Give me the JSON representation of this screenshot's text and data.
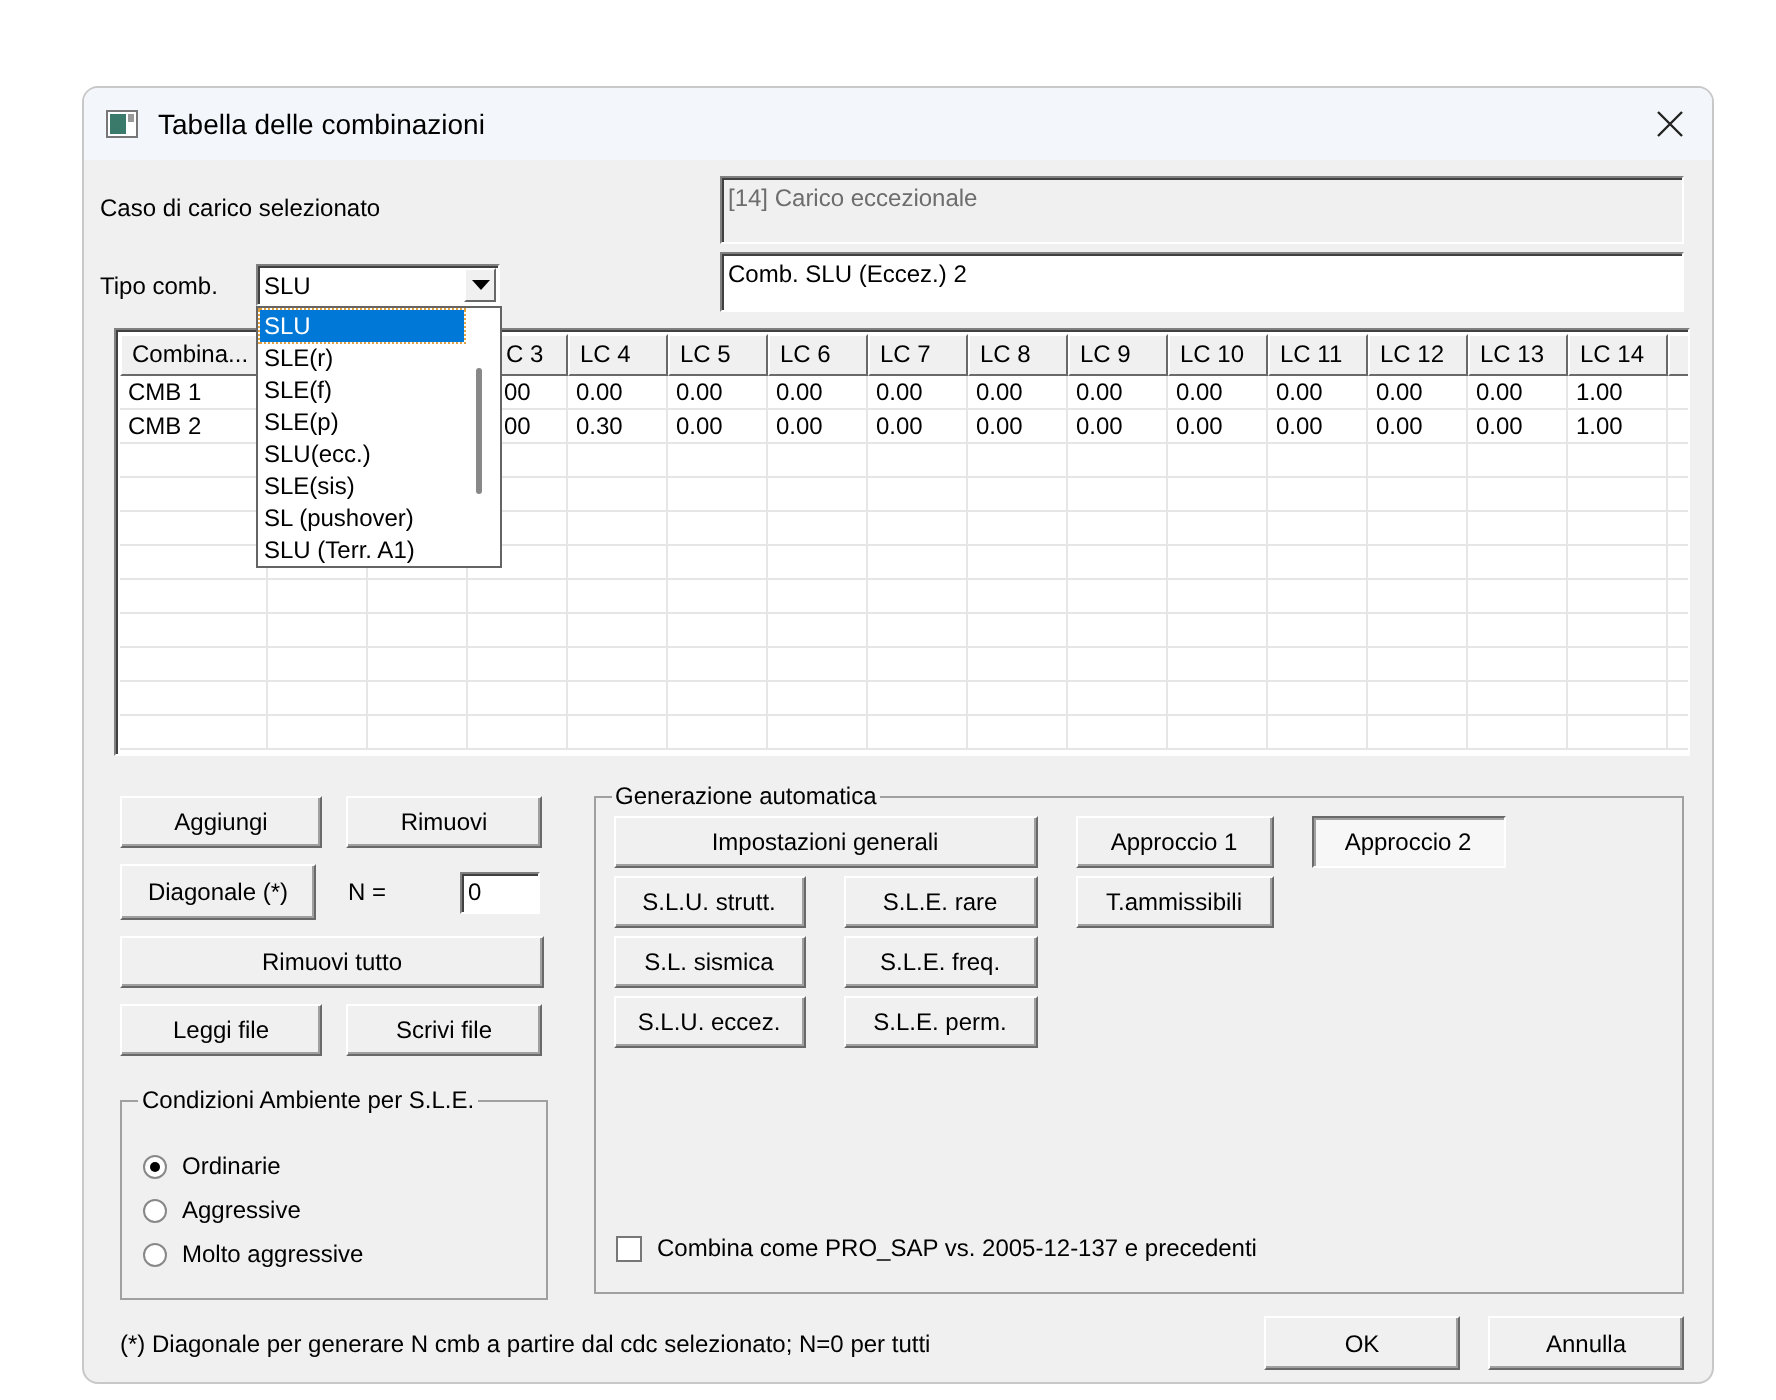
{
  "window": {
    "title": "Tabella delle combinazioni"
  },
  "selected_load_case": {
    "label": "Caso di carico selezionato",
    "value": "[14] Carico eccezionale"
  },
  "combination_type": {
    "label": "Tipo comb.",
    "value": "SLU",
    "expanded": true,
    "options": [
      {
        "label": "SLU",
        "selected": true
      },
      {
        "label": "SLE(r)",
        "selected": false
      },
      {
        "label": "SLE(f)",
        "selected": false
      },
      {
        "label": "SLE(p)",
        "selected": false
      },
      {
        "label": "SLU(ecc.)",
        "selected": false
      },
      {
        "label": "SLE(sis)",
        "selected": false
      },
      {
        "label": "SL (pushover)",
        "selected": false
      },
      {
        "label": "SLU (Terr. A1)",
        "selected": false
      }
    ]
  },
  "combination_name": {
    "value": "Comb. SLU (Eccez.) 2"
  },
  "table": {
    "columns": [
      "Combina...",
      "C 3",
      "LC 4",
      "LC 5",
      "LC 6",
      "LC 7",
      "LC 8",
      "LC 9",
      "LC 10",
      "LC 11",
      "LC 12",
      "LC 13",
      "LC 14"
    ],
    "rows": [
      {
        "cells": [
          "CMB 1",
          "00",
          "0.00",
          "0.00",
          "0.00",
          "0.00",
          "0.00",
          "0.00",
          "0.00",
          "0.00",
          "0.00",
          "0.00",
          "1.00"
        ]
      },
      {
        "cells": [
          "CMB 2",
          "00",
          "0.30",
          "0.00",
          "0.00",
          "0.00",
          "0.00",
          "0.00",
          "0.00",
          "0.00",
          "0.00",
          "0.00",
          "1.00"
        ]
      }
    ]
  },
  "edit_buttons": {
    "add": "Aggiungi",
    "remove": "Rimuovi",
    "diagonal": "Diagonale (*)",
    "remove_all": "Rimuovi tutto",
    "read_file": "Leggi file",
    "write_file": "Scrivi file"
  },
  "n_field": {
    "label": "N =",
    "value": "0"
  },
  "environment": {
    "title": "Condizioni Ambiente per S.L.E.",
    "options": [
      {
        "label": "Ordinarie",
        "selected": true
      },
      {
        "label": "Aggressive",
        "selected": false
      },
      {
        "label": "Molto aggressive",
        "selected": false
      }
    ]
  },
  "auto_generation": {
    "title": "Generazione automatica",
    "buttons": [
      "Impostazioni generali",
      "S.L.U. strutt.",
      "S.L.E. rare",
      "T.ammissibili",
      "S.L. sismica",
      "S.L.E. freq.",
      "S.L.U. eccez.",
      "S.L.E. perm."
    ],
    "approaches": [
      {
        "label": "Approccio 1",
        "selected": false
      },
      {
        "label": "Approccio 2",
        "selected": true
      }
    ],
    "legacy_option": {
      "label": "Combina come PRO_SAP vs. 2005-12-137 e precedenti",
      "checked": false
    }
  },
  "footnote": "(*) Diagonale per generare N cmb a partire dal cdc selezionato; N=0 per tutti",
  "dialog_buttons": [
    "OK",
    "Annulla"
  ]
}
